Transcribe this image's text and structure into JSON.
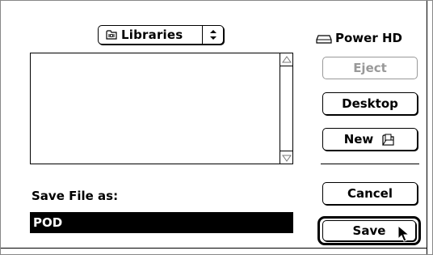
{
  "folder_popup": {
    "label": "Libraries",
    "icon": "folder-icon"
  },
  "volume": {
    "label": "Power HD",
    "icon": "hard-drive-icon"
  },
  "buttons": {
    "eject": "Eject",
    "desktop": "Desktop",
    "new": "New",
    "cancel": "Cancel",
    "save": "Save"
  },
  "save_field": {
    "label": "Save File as:",
    "value": "POD"
  }
}
